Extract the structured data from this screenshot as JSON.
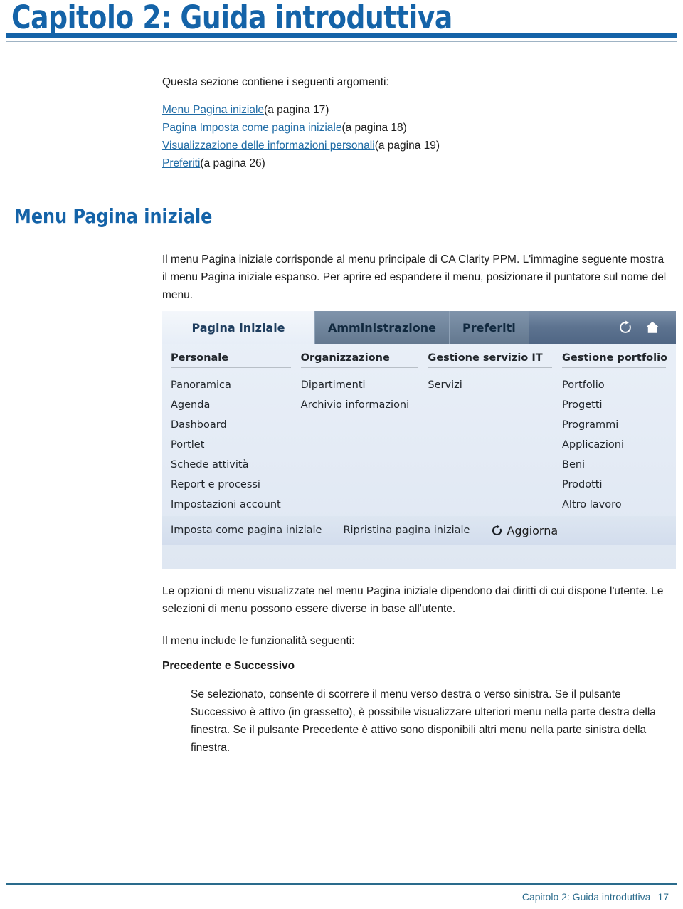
{
  "chapter": {
    "title": "Capitolo 2: Guida introduttiva"
  },
  "intro": {
    "lead": "Questa sezione contiene i seguenti argomenti:",
    "toc": [
      {
        "link": "Menu Pagina iniziale",
        "ref": "(a pagina 17)"
      },
      {
        "link": "Pagina Imposta come pagina iniziale",
        "ref": "(a pagina 18)"
      },
      {
        "link": "Visualizzazione delle informazioni personali",
        "ref": "(a pagina 19)"
      },
      {
        "link": "Preferiti",
        "ref": "(a pagina 26)"
      }
    ]
  },
  "section": {
    "heading": "Menu Pagina iniziale",
    "para_intro": "Il menu Pagina iniziale corrisponde al menu principale di CA Clarity PPM. L'immagine seguente mostra il menu Pagina iniziale espanso. Per aprire ed espandere il menu, posizionare il puntatore sul nome del menu.",
    "para_after": "Le opzioni di menu visualizzate nel menu Pagina iniziale dipendono dai diritti di cui dispone l'utente. Le selezioni di menu possono essere diverse in base all'utente.",
    "para_include": "Il menu include le funzionalità seguenti:",
    "sub_heading": "Precedente e Successivo",
    "sub_para": "Se selezionato, consente di scorrere il menu verso destra o verso sinistra. Se il pulsante Successivo è attivo (in grassetto), è possibile visualizzare ulteriori menu nella parte destra della finestra. Se il pulsante Precedente è attivo sono disponibili altri menu nella parte sinistra della finestra."
  },
  "screenshot": {
    "tabs": [
      {
        "label": "Pagina iniziale",
        "active": true
      },
      {
        "label": "Amministrazione",
        "active": false
      },
      {
        "label": "Preferiti",
        "active": false
      }
    ],
    "nav_icons": [
      {
        "name": "refresh-icon"
      },
      {
        "name": "home-icon"
      }
    ],
    "columns": [
      {
        "header": "Personale",
        "items": [
          "Panoramica",
          "Agenda",
          "Dashboard",
          "Portlet",
          "Schede attività",
          "Report e processi",
          "Impostazioni account"
        ]
      },
      {
        "header": "Organizzazione",
        "items": [
          "Dipartimenti",
          "Archivio informazioni"
        ]
      },
      {
        "header": "Gestione servizio IT",
        "items": [
          "Servizi"
        ]
      },
      {
        "header": "Gestione portfolio",
        "items": [
          "Portfolio",
          "Progetti",
          "Programmi",
          "Applicazioni",
          "Beni",
          "Prodotti",
          "Altro lavoro"
        ]
      }
    ],
    "footer_actions": [
      "Imposta come pagina iniziale",
      "Ripristina pagina iniziale"
    ],
    "refresh_label": "Aggiorna"
  },
  "page_footer": {
    "text": "Capitolo 2: Guida introduttiva",
    "page_number": "17"
  },
  "colors": {
    "title_blue": "#1463a8",
    "link_blue": "#1f6ba5",
    "footer_blue": "#2a6b8c",
    "navbar_dark": "#5d7390",
    "panel_bg": "#e8eef6"
  }
}
